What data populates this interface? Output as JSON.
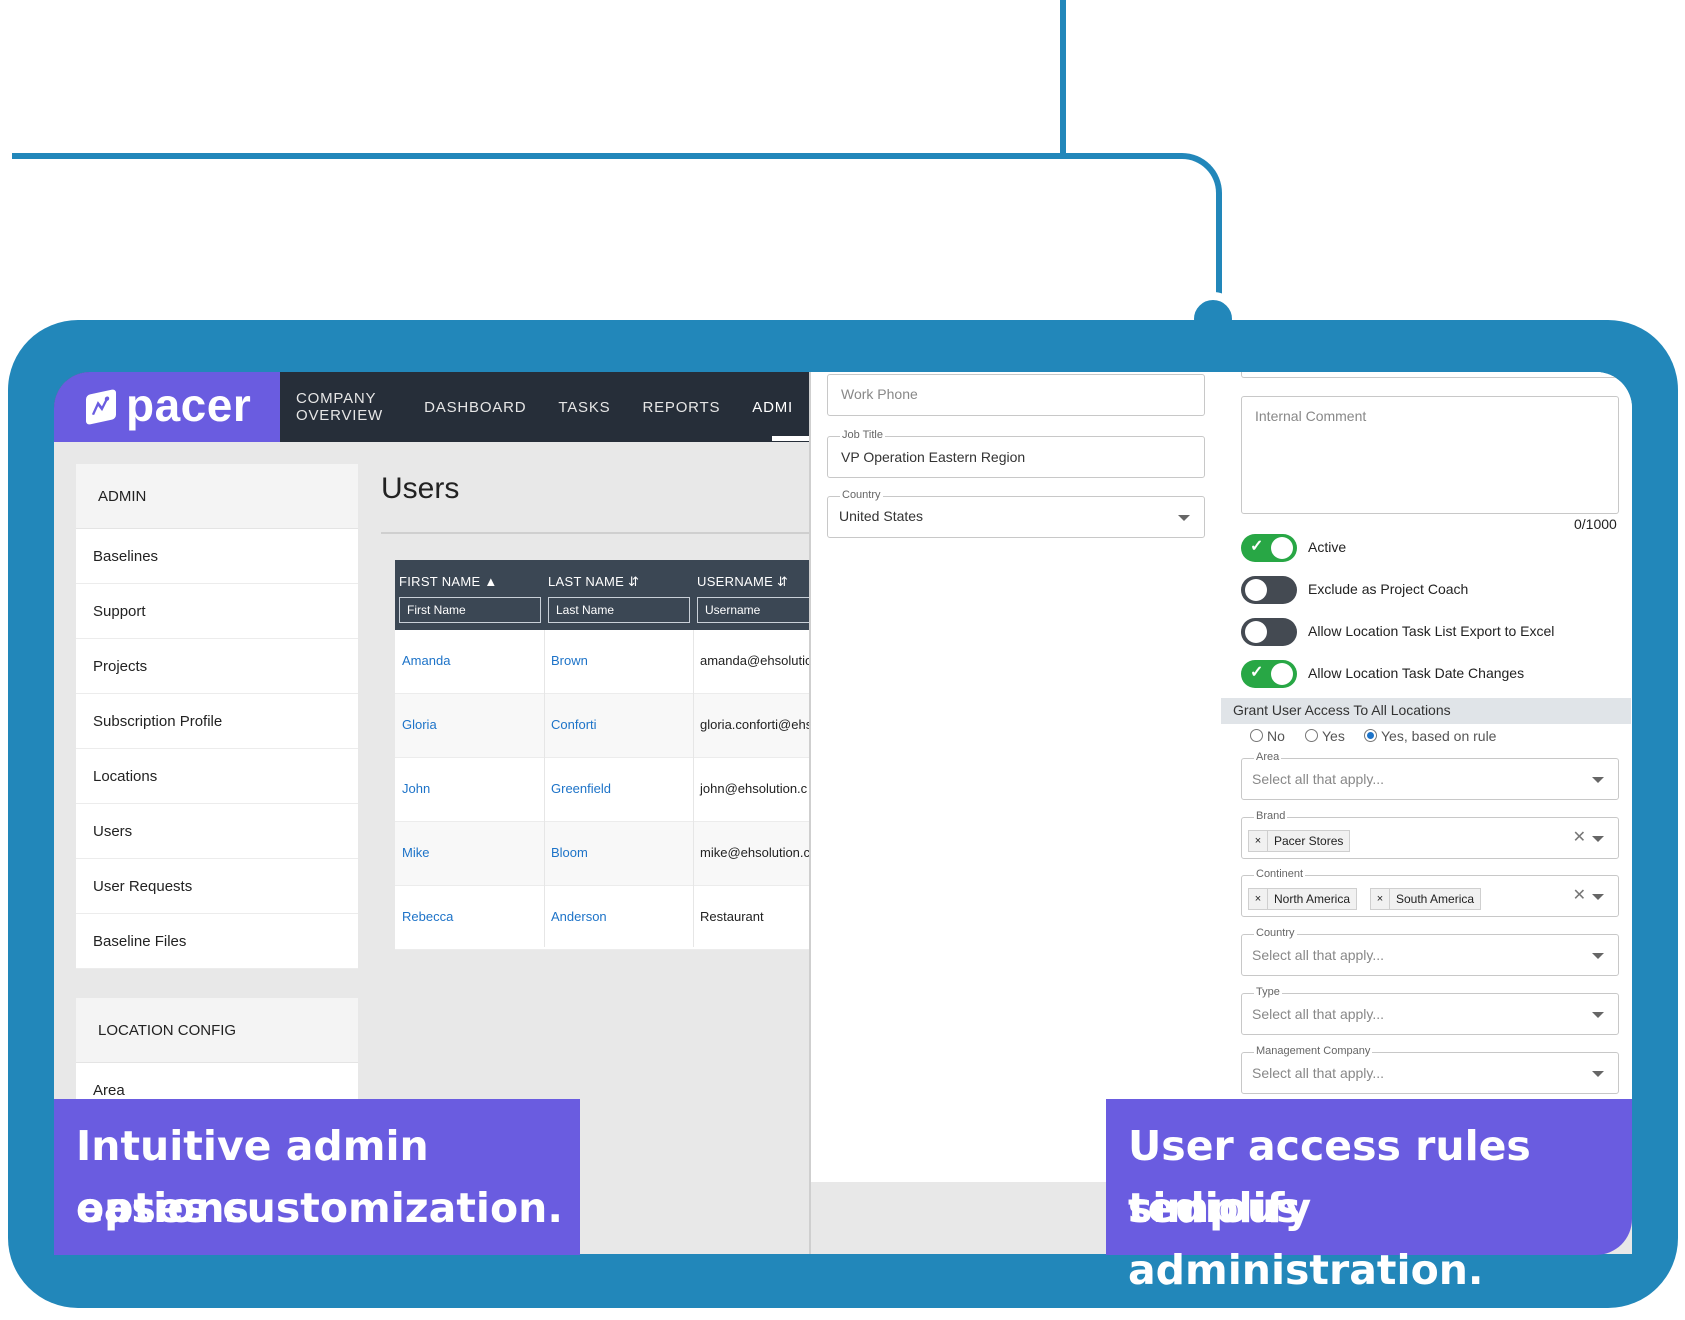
{
  "brand": {
    "logo_text": "pacer"
  },
  "nav": {
    "items": [
      "COMPANY OVERVIEW",
      "DASHBOARD",
      "TASKS",
      "REPORTS",
      "ADMI"
    ]
  },
  "sidebar": {
    "admin_header": "ADMIN",
    "items": [
      "Baselines",
      "Support",
      "Projects",
      "Subscription Profile",
      "Locations",
      "Users",
      "User Requests",
      "Baseline Files"
    ],
    "location_header": "LOCATION CONFIG",
    "location_items": [
      "Area"
    ]
  },
  "main": {
    "title": "Users"
  },
  "table": {
    "headers": [
      "FIRST NAME",
      "LAST NAME",
      "USERNAME"
    ],
    "filters": [
      "First Name",
      "Last Name",
      "Username"
    ],
    "rows": [
      [
        "Amanda",
        "Brown",
        "amanda@ehsolutio"
      ],
      [
        "Gloria",
        "Conforti",
        "gloria.conforti@ehs"
      ],
      [
        "John",
        "Greenfield",
        "john@ehsolution.c"
      ],
      [
        "Mike",
        "Bloom",
        "mike@ehsolution.c"
      ],
      [
        "Rebecca",
        "Anderson",
        "Restaurant"
      ]
    ]
  },
  "form": {
    "work_phone_placeholder": "Work Phone",
    "job_title_label": "Job Title",
    "job_title_value": "VP Operation Eastern Region",
    "country_label": "Country",
    "country_value": "United States",
    "internal_comment_placeholder": "Internal Comment",
    "comment_count": "0/1000",
    "toggles": [
      {
        "label": "Active",
        "on": true
      },
      {
        "label": "Exclude as Project Coach",
        "on": false
      },
      {
        "label": "Allow Location Task List Export to Excel",
        "on": false
      },
      {
        "label": "Allow Location Task Date Changes",
        "on": true
      }
    ],
    "grant_header": "Grant User Access To All Locations",
    "grant_options": [
      "No",
      "Yes",
      "Yes, based on rule"
    ],
    "grant_selected": "Yes, based on rule",
    "area_label": "Area",
    "area_placeholder": "Select all that apply...",
    "brand_label": "Brand",
    "brand_chips": [
      "Pacer Stores"
    ],
    "continent_label": "Continent",
    "continent_chips": [
      "North America",
      "South America"
    ],
    "country_multi_label": "Country",
    "country_placeholder": "Select all that apply...",
    "type_label": "Type",
    "type_placeholder": "Select all that apply...",
    "mgmt_label": "Management Company",
    "mgmt_placeholder": "Select all that apply..."
  },
  "captions": {
    "left_line1": "Intuitive admin options",
    "left_line2": "eases customization.",
    "right_line1": "User access rules simplify",
    "right_line2": "tedious administration."
  },
  "colors": {
    "frame": "#2287ba",
    "brand_purple": "#6a5ce0",
    "nav_dark": "#262e39",
    "toggle_on": "#28a745",
    "link": "#1d73c8"
  }
}
